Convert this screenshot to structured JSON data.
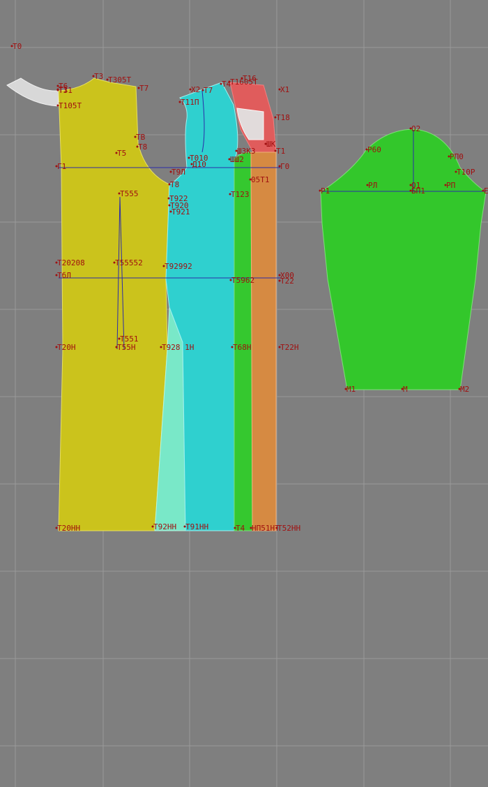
{
  "colors": {
    "background": "#7f7f7f",
    "grid": "#9a9a9a",
    "front_panel": "#cbc31c",
    "side_front_panel": "#2fd0cf",
    "side_wedge": "#79e8c8",
    "side_strip": "#35c82f",
    "back_strip": "#d68a42",
    "shoulder_piece": "#e05c5c",
    "yoke_piece": "#e2e2e2",
    "sleeve": "#33c72b",
    "construction_line": "#2b2ba8",
    "label": "#a01010"
  },
  "pattern": {
    "pieces": [
      {
        "id": "front-panel",
        "name": "front-panel",
        "color_key": "front_panel"
      },
      {
        "id": "side-wedge",
        "name": "side-wedge",
        "color_key": "side_wedge"
      },
      {
        "id": "side-front-panel",
        "name": "side-front-panel",
        "color_key": "side_front_panel"
      },
      {
        "id": "side-strip",
        "name": "side-strip",
        "color_key": "side_strip"
      },
      {
        "id": "back-strip",
        "name": "back-strip",
        "color_key": "back_strip"
      },
      {
        "id": "shoulder-piece",
        "name": "shoulder-piece",
        "color_key": "shoulder_piece"
      },
      {
        "id": "shoulder-insert",
        "name": "shoulder-insert",
        "color_key": "yoke_piece"
      },
      {
        "id": "neck-facing",
        "name": "neck-facing",
        "color_key": "yoke_piece"
      },
      {
        "id": "sleeve",
        "name": "sleeve",
        "color_key": "sleeve"
      }
    ],
    "labels": [
      {
        "id": "t0",
        "text": "T0"
      },
      {
        "id": "t3",
        "text": "T3"
      },
      {
        "id": "t305t",
        "text": "T305T"
      },
      {
        "id": "t7",
        "text": "T7"
      },
      {
        "id": "t31",
        "text": "T31"
      },
      {
        "id": "t105t",
        "text": "T105T"
      },
      {
        "id": "t1",
        "text": "T1"
      },
      {
        "id": "t6",
        "text": "T6"
      },
      {
        "id": "tb",
        "text": "TB"
      },
      {
        "id": "t8",
        "text": "T8"
      },
      {
        "id": "t5",
        "text": "T5"
      },
      {
        "id": "g1",
        "text": "Г1"
      },
      {
        "id": "t555",
        "text": "T555"
      },
      {
        "id": "t208",
        "text": "T20208"
      },
      {
        "id": "t552",
        "text": "T55552"
      },
      {
        "id": "t92a",
        "text": "T92992"
      },
      {
        "id": "t0b",
        "text": "TбЛ"
      },
      {
        "id": "t551",
        "text": "T551"
      },
      {
        "id": "t20h",
        "text": "T20H"
      },
      {
        "id": "t55h",
        "text": "T55H"
      },
      {
        "id": "t92h",
        "text": "T928 1H"
      },
      {
        "id": "t68h",
        "text": "T68H"
      },
      {
        "id": "t22h",
        "text": "T22H"
      },
      {
        "id": "t20hh",
        "text": "T20HH"
      },
      {
        "id": "t92hh",
        "text": "T92HH"
      },
      {
        "id": "t91hh",
        "text": "T91HH"
      },
      {
        "id": "t4",
        "text": "T4"
      },
      {
        "id": "hp51",
        "text": "HП51HT"
      },
      {
        "id": "t52hh",
        "text": "T52HH"
      },
      {
        "id": "x2",
        "text": "X2"
      },
      {
        "id": "t7b",
        "text": "T7"
      },
      {
        "id": "t14",
        "text": "T4"
      },
      {
        "id": "t16",
        "text": "T16"
      },
      {
        "id": "t1605t",
        "text": "T1605T"
      },
      {
        "id": "x1",
        "text": "X1"
      },
      {
        "id": "t11p",
        "text": "T11П"
      },
      {
        "id": "t18",
        "text": "T18"
      },
      {
        "id": "t010",
        "text": "T010"
      },
      {
        "id": "d10",
        "text": "Д10"
      },
      {
        "id": "t8b",
        "text": "T8"
      },
      {
        "id": "t9a",
        "text": "T9Л"
      },
      {
        "id": "t922",
        "text": "T922"
      },
      {
        "id": "t920",
        "text": "T920"
      },
      {
        "id": "t921",
        "text": "T921"
      },
      {
        "id": "shk",
        "text": "ШК"
      },
      {
        "id": "shk3",
        "text": "ШЗК3"
      },
      {
        "id": "shk2",
        "text": "ШШ2"
      },
      {
        "id": "t11",
        "text": "Т1"
      },
      {
        "id": "g0",
        "text": "Г0"
      },
      {
        "id": "t123",
        "text": "T123"
      },
      {
        "id": "t05t1",
        "text": "05T1"
      },
      {
        "id": "t962",
        "text": "T5962"
      },
      {
        "id": "x00",
        "text": "X00"
      },
      {
        "id": "t22",
        "text": "T22"
      },
      {
        "id": "o2",
        "text": "O2"
      },
      {
        "id": "r60",
        "text": "P60"
      },
      {
        "id": "rp0",
        "text": "PП0"
      },
      {
        "id": "t10r",
        "text": "T10P"
      },
      {
        "id": "r1",
        "text": "P1"
      },
      {
        "id": "rl",
        "text": "PЛ"
      },
      {
        "id": "o1",
        "text": "O1"
      },
      {
        "id": "bp1",
        "text": "БП1"
      },
      {
        "id": "rp",
        "text": "PП"
      },
      {
        "id": "e1",
        "text": "E"
      },
      {
        "id": "m1",
        "text": "M1"
      },
      {
        "id": "m",
        "text": "M"
      },
      {
        "id": "m2",
        "text": "M2"
      }
    ]
  }
}
